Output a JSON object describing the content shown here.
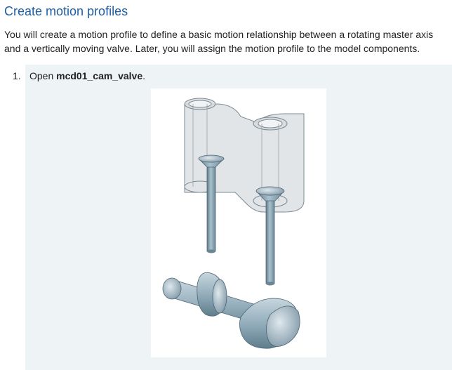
{
  "heading": "Create motion profiles",
  "intro": "You will create a motion profile to define a basic motion relationship between a rotating master axis and a vertically moving valve. Later, you will assign the motion profile to the model components.",
  "steps": [
    {
      "number": "1.",
      "prefix": "Open ",
      "file": "mcd01_cam_valve",
      "suffix": "."
    }
  ]
}
